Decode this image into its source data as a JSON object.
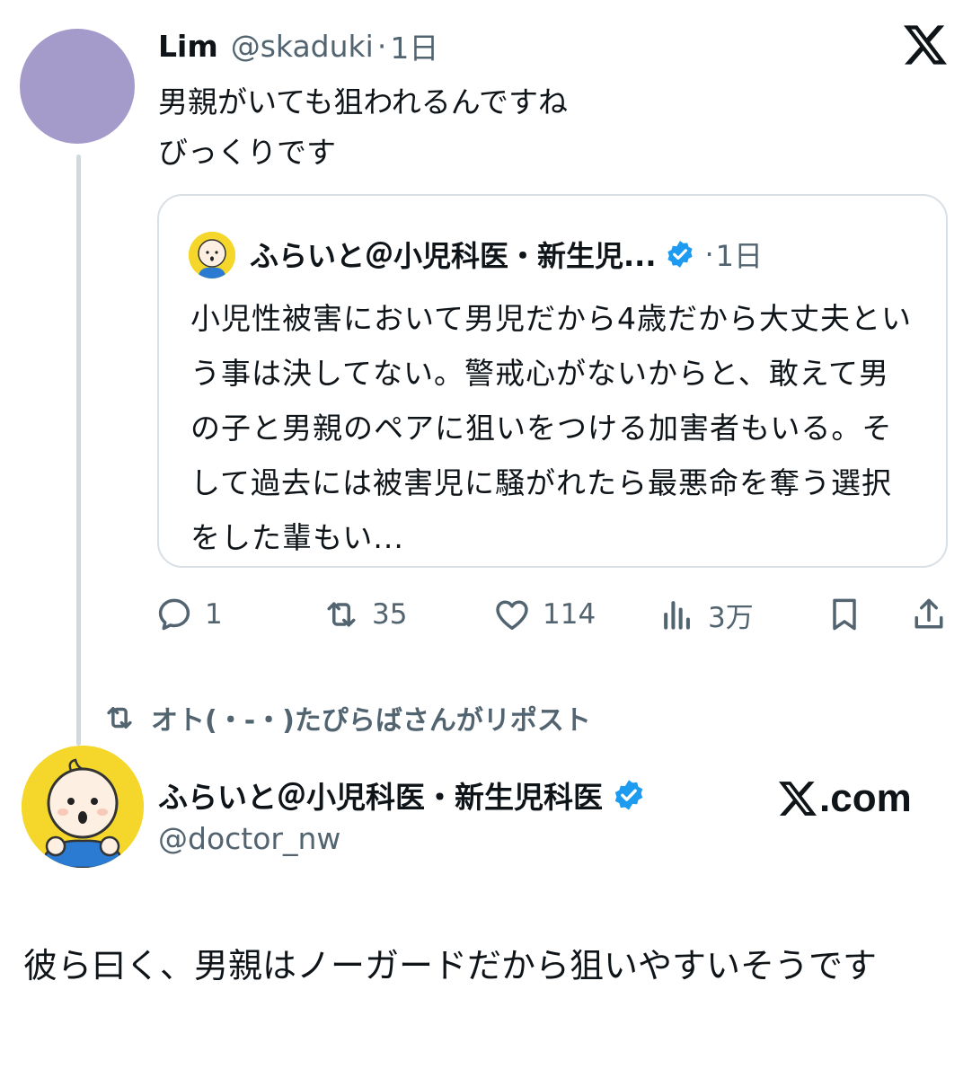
{
  "tweet1": {
    "name": "Lim",
    "handle": "@skaduki",
    "separator": "·",
    "time": "1日",
    "text": "男親がいても狙われるんですね\nびっくりです",
    "avatar_color": "#a59bca"
  },
  "quote": {
    "name": "ふらいと＠小児科医・新生児...",
    "separator": "·",
    "time": "1日",
    "text": "小児性被害において男児だから4歳だから大丈夫という事は決してない。警戒心がないからと、敢えて男の子と男親のペアに狙いをつける加害者もいる。そして過去には被害児に騒がれたら最悪命を奪う選択をした輩もい..."
  },
  "actions": {
    "reply_count": "1",
    "repost_count": "35",
    "like_count": "114",
    "views_count": "3万"
  },
  "repost_notice": "オト(・-・)たぴらばさんがリポスト",
  "tweet2": {
    "name": "ふらいと＠小児科医・新生児科医",
    "handle": "@doctor_nw",
    "source": ".com",
    "text": "彼ら曰く、男親はノーガードだから狙いやすいそうです"
  },
  "colors": {
    "verified": "#1d9bf0",
    "muted": "#536471",
    "border": "#d9e0e5"
  }
}
